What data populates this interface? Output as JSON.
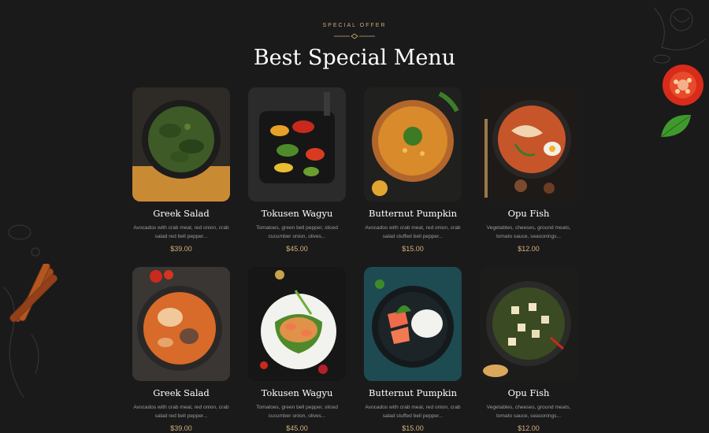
{
  "header": {
    "eyebrow": "SPECIAL OFFER",
    "title": "Best Special Menu"
  },
  "colors": {
    "background": "#1a1a1a",
    "accent": "#d6b07a",
    "text_muted": "#9c9c9c"
  },
  "menu": [
    {
      "name": "Greek Salad",
      "desc": "Avocados with crab meat, red onion, crab salad red bell pepper...",
      "price": "$39.00",
      "image": "dish-green-curry-chicken"
    },
    {
      "name": "Tokusen Wagyu",
      "desc": "Tomatoes, green bell pepper, sliced cucumber onion, olives...",
      "price": "$45.00",
      "image": "dish-grilled-vegetables"
    },
    {
      "name": "Butternut Pumpkin",
      "desc": "Avocados with crab meat, red onion, crab salad stuffed bell pepper...",
      "price": "$15.00",
      "image": "dish-pumpkin-soup"
    },
    {
      "name": "Opu Fish",
      "desc": "Vegetables, cheeses, ground meats, tomato sauce, seasonings...",
      "price": "$12.00",
      "image": "dish-shrimp-ramen"
    },
    {
      "name": "Greek Salad",
      "desc": "Avocados with crab meat, red onion, crab salad red bell pepper...",
      "price": "$39.00",
      "image": "dish-orange-curry"
    },
    {
      "name": "Tokusen Wagyu",
      "desc": "Tomatoes, green bell pepper, sliced cucumber onion, olives...",
      "price": "$45.00",
      "image": "dish-pad-thai"
    },
    {
      "name": "Butternut Pumpkin",
      "desc": "Avocados with crab meat, red onion, crab salad stuffed bell pepper...",
      "price": "$15.00",
      "image": "dish-salmon-rice"
    },
    {
      "name": "Opu Fish",
      "desc": "Vegetables, cheeses, ground meats, tomato sauce, seasonings...",
      "price": "$12.00",
      "image": "dish-palak-paneer"
    }
  ]
}
